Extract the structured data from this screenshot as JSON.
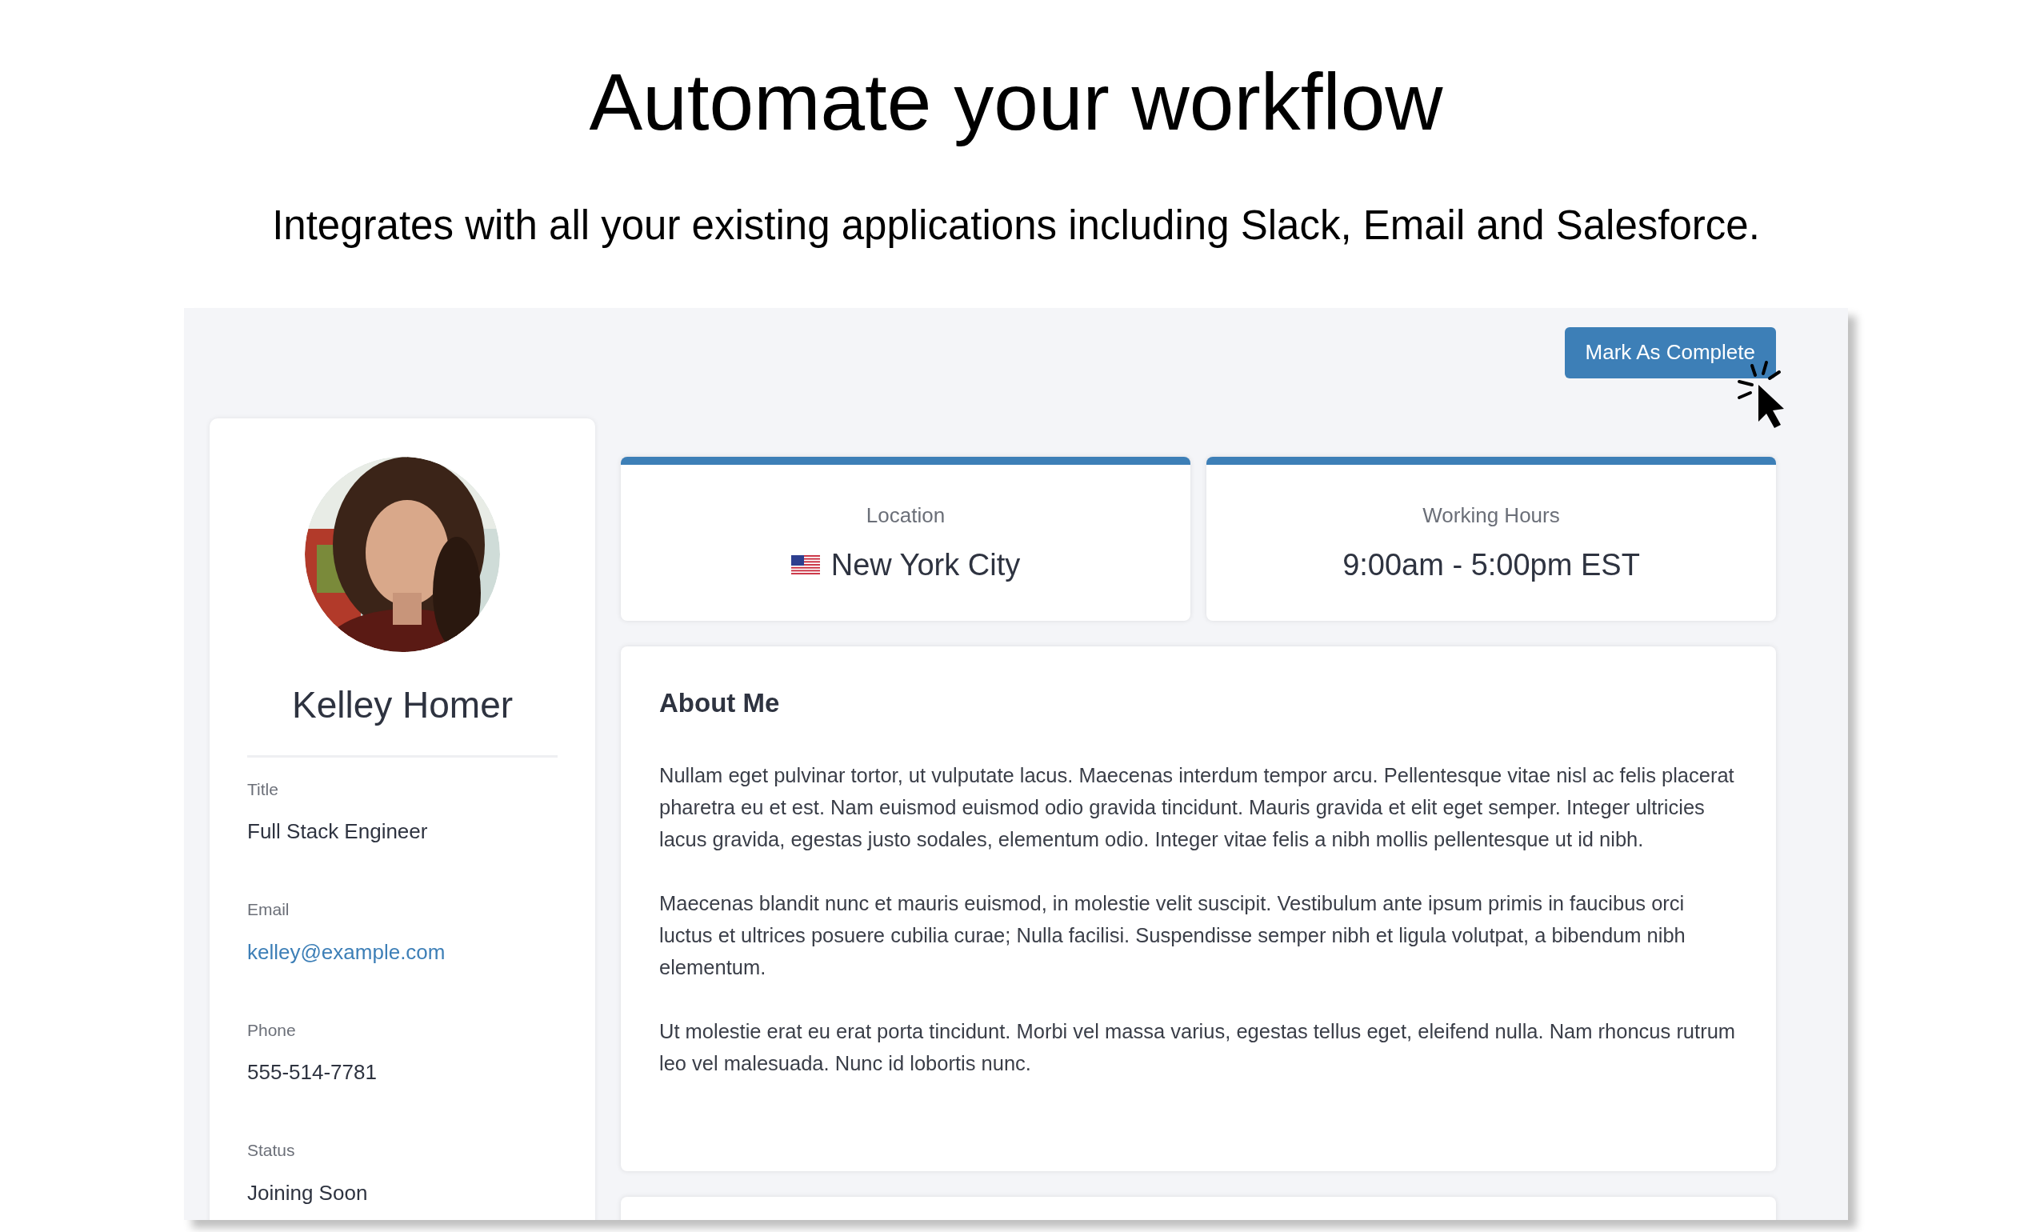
{
  "heading": "Automate your workflow",
  "subheading": "Integrates with all your existing applications including Slack, Email and Salesforce.",
  "action_button": "Mark As Complete",
  "profile": {
    "name": "Kelley Homer",
    "fields": [
      {
        "label": "Title",
        "value": "Full Stack Engineer",
        "kind": "text"
      },
      {
        "label": "Email",
        "value": "kelley@example.com",
        "kind": "link"
      },
      {
        "label": "Phone",
        "value": "555-514-7781",
        "kind": "text"
      },
      {
        "label": "Status",
        "value": "Joining Soon",
        "kind": "text"
      }
    ]
  },
  "info_cards": [
    {
      "label": "Location",
      "value": "New York City",
      "kind": "flag"
    },
    {
      "label": "Working Hours",
      "value": "9:00am - 5:00pm EST",
      "kind": "plain"
    }
  ],
  "about": {
    "title": "About Me",
    "paragraphs": [
      "Nullam eget pulvinar tortor, ut vulputate lacus. Maecenas interdum tempor arcu. Pellentesque vitae nisl ac felis placerat pharetra eu et est. Nam euismod euismod odio gravida tincidunt. Mauris gravida et elit eget semper. Integer ultricies lacus gravida, egestas justo sodales, elementum odio. Integer vitae felis a nibh mollis pellentesque ut id nibh.",
      "Maecenas blandit nunc et mauris euismod, in molestie velit suscipit. Vestibulum ante ipsum primis in faucibus orci luctus et ultrices posuere cubilia curae; Nulla facilisi. Suspendisse semper nibh et ligula volutpat, a bibendum nibh elementum.",
      "Ut molestie erat eu erat porta tincidunt. Morbi vel massa varius, egestas tellus eget, eleifend nulla. Nam rhoncus rutrum leo vel malesuada. Nunc id lobortis nunc."
    ]
  }
}
